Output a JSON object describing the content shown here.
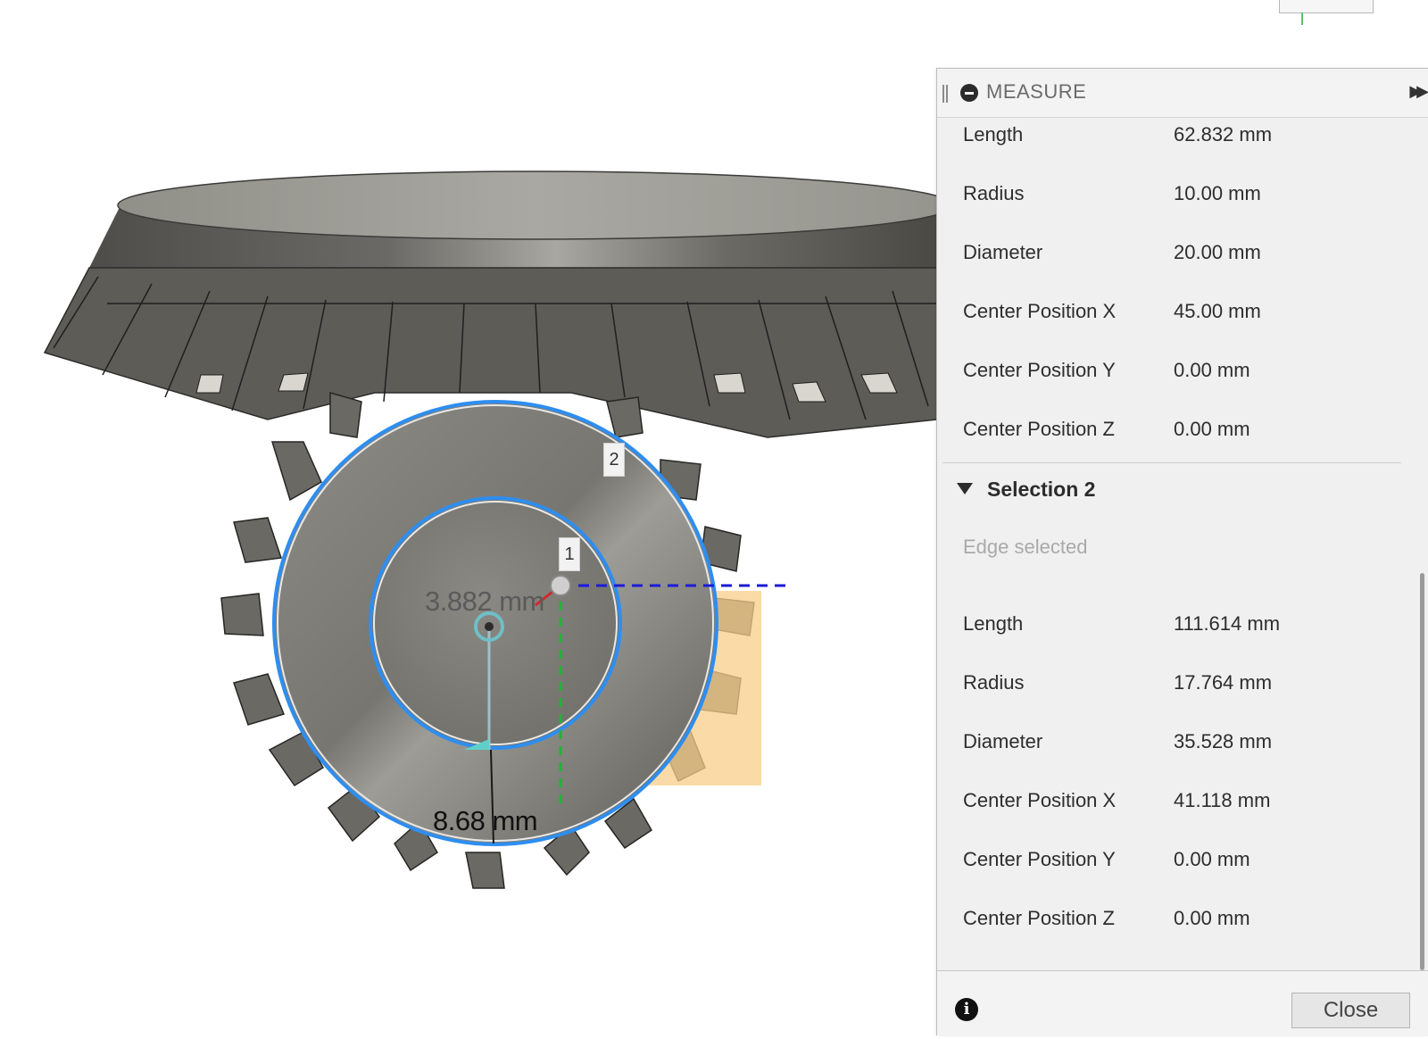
{
  "viewport": {
    "dim_radius": "3.882 mm",
    "dim_bottom": "8.68 mm",
    "marker_1": "1",
    "marker_2": "2"
  },
  "panel": {
    "title": "MEASURE",
    "selection1": {
      "rows": [
        {
          "label": "Length",
          "value": "62.832 mm"
        },
        {
          "label": "Radius",
          "value": "10.00 mm"
        },
        {
          "label": "Diameter",
          "value": "20.00 mm"
        },
        {
          "label": "Center Position X",
          "value": "45.00 mm"
        },
        {
          "label": "Center Position Y",
          "value": "0.00 mm"
        },
        {
          "label": "Center Position Z",
          "value": "0.00 mm"
        }
      ]
    },
    "selection2": {
      "title": "Selection 2",
      "status": "Edge selected",
      "rows": [
        {
          "label": "Length",
          "value": "111.614 mm"
        },
        {
          "label": "Radius",
          "value": "17.764 mm"
        },
        {
          "label": "Diameter",
          "value": "35.528 mm"
        },
        {
          "label": "Center Position X",
          "value": "41.118 mm"
        },
        {
          "label": "Center Position Y",
          "value": "0.00 mm"
        },
        {
          "label": "Center Position Z",
          "value": "0.00 mm"
        }
      ]
    },
    "close_label": "Close"
  },
  "icons": {
    "header": "minus-circle-icon",
    "expand": "double-chevron-right-icon",
    "info": "info-icon",
    "collapse": "triangle-down-icon"
  },
  "colors": {
    "selection_blue": "#2e8ef0",
    "gear_dark": "#5b5a55",
    "highlight_orange": "#f8cf8a"
  }
}
